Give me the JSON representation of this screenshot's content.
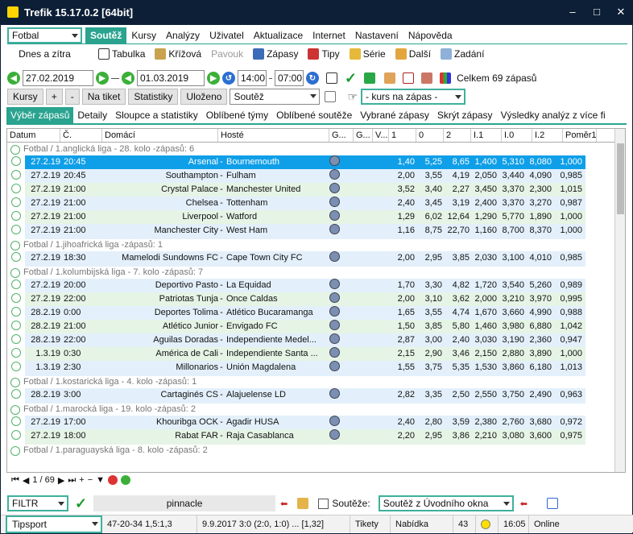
{
  "window": {
    "title": "Trefik 15.17.0.2 [64bit]"
  },
  "sport_select": "Fotbal",
  "menu": [
    "Soutěž",
    "Kursy",
    "Analýzy",
    "Uživatel",
    "Aktualizace",
    "Internet",
    "Nastavení",
    "Nápověda"
  ],
  "period_select": "Dnes a zítra",
  "toolbar": {
    "tabulka": "Tabulka",
    "krizova": "Křížová",
    "pavouk": "Pavouk",
    "zapasy": "Zápasy",
    "tipy": "Tipy",
    "serie": "Série",
    "dalsi": "Další",
    "zadani": "Zadání"
  },
  "dates": {
    "from": "27.02.2019",
    "to": "01.03.2019",
    "time_from": "14:00",
    "time_to": "07:00",
    "celkem": "Celkem 69 zápasů"
  },
  "buttons": {
    "kursy": "Kursy",
    "plus": "+",
    "minus": "-",
    "na_tiket": "Na tiket",
    "statistiky": "Statistiky",
    "ulozeno": "Uloženo",
    "soutez": "Soutěž",
    "kurs": "- kurs na zápas -"
  },
  "tabs": [
    "Výběr zápasů",
    "Detaily",
    "Sloupce a statistiky",
    "Oblíbené týmy",
    "Oblíbené soutěže",
    "Vybrané zápasy",
    "Skrýt zápasy",
    "Výsledky analýz z více fi"
  ],
  "columns": [
    "Datum",
    "Č.",
    "Domácí",
    "Hosté",
    "G...",
    "G...",
    "V...",
    "1",
    "0",
    "2",
    "I.1",
    "I.0",
    "I.2",
    "Poměr1"
  ],
  "groups": [
    {
      "label": "Fotbal / 1.anglická liga - 28. kolo -zápasů: 6",
      "rows": [
        [
          "27.2.19",
          "20:45",
          "Arsenal",
          "Bournemouth",
          "1,40",
          "5,25",
          "8,65",
          "1,400",
          "5,310",
          "8,080",
          "1,000",
          "sel"
        ],
        [
          "27.2.19",
          "20:45",
          "Southampton",
          "Fulham",
          "2,00",
          "3,55",
          "4,19",
          "2,050",
          "3,440",
          "4,090",
          "0,985",
          "alt"
        ],
        [
          "27.2.19",
          "21:00",
          "Crystal Palace",
          "Manchester United",
          "3,52",
          "3,40",
          "2,27",
          "3,450",
          "3,370",
          "2,300",
          "1,015",
          "green-row"
        ],
        [
          "27.2.19",
          "21:00",
          "Chelsea",
          "Tottenham",
          "2,40",
          "3,45",
          "3,19",
          "2,400",
          "3,370",
          "3,270",
          "0,987",
          "alt"
        ],
        [
          "27.2.19",
          "21:00",
          "Liverpool",
          "Watford",
          "1,29",
          "6,02",
          "12,64",
          "1,290",
          "5,770",
          "1,890",
          "1,000",
          "green-row"
        ],
        [
          "27.2.19",
          "21:00",
          "Manchester City",
          "West Ham",
          "1,16",
          "8,75",
          "22,70",
          "1,160",
          "8,700",
          "8,370",
          "1,000",
          "alt"
        ]
      ]
    },
    {
      "label": "Fotbal / 1.jihoafrická liga -zápasů: 1",
      "rows": [
        [
          "27.2.19",
          "18:30",
          "Mamelodi Sundowns FC",
          "Cape Town City FC",
          "2,00",
          "2,95",
          "3,85",
          "2,030",
          "3,100",
          "4,010",
          "0,985",
          "alt"
        ]
      ]
    },
    {
      "label": "Fotbal / 1.kolumbijská liga - 7. kolo -zápasů: 7",
      "rows": [
        [
          "27.2.19",
          "20:00",
          "Deportivo Pasto",
          "La Equidad",
          "1,70",
          "3,30",
          "4,82",
          "1,720",
          "3,540",
          "5,260",
          "0,989",
          "alt"
        ],
        [
          "27.2.19",
          "22:00",
          "Patriotas Tunja",
          "Once Caldas",
          "2,00",
          "3,10",
          "3,62",
          "2,000",
          "3,210",
          "3,970",
          "0,995",
          "green-row"
        ],
        [
          "28.2.19",
          "0:00",
          "Deportes Tolima",
          "Atlético Bucaramanga",
          "1,65",
          "3,55",
          "4,74",
          "1,670",
          "3,660",
          "4,990",
          "0,988",
          "alt"
        ],
        [
          "28.2.19",
          "21:00",
          "Atlético Junior",
          "Envigado FC",
          "1,50",
          "3,85",
          "5,80",
          "1,460",
          "3,980",
          "6,880",
          "1,042",
          "green-row"
        ],
        [
          "28.2.19",
          "22:00",
          "Aguilas Doradas",
          "Independiente Medel...",
          "2,87",
          "3,00",
          "2,40",
          "3,030",
          "3,190",
          "2,360",
          "0,947",
          "alt"
        ],
        [
          "1.3.19",
          "0:30",
          "América de Cali",
          "Independiente Santa ...",
          "2,15",
          "2,90",
          "3,46",
          "2,150",
          "2,880",
          "3,890",
          "1,000",
          "green-row"
        ],
        [
          "1.3.19",
          "2:30",
          "Millonarios",
          "Unión Magdalena",
          "1,55",
          "3,75",
          "5,35",
          "1,530",
          "3,860",
          "6,180",
          "1,013",
          "alt"
        ]
      ]
    },
    {
      "label": "Fotbal / 1.kostarická liga - 4. kolo -zápasů: 1",
      "rows": [
        [
          "28.2.19",
          "3:00",
          "Cartaginés CS",
          "Alajuelense LD",
          "2,82",
          "3,35",
          "2,50",
          "2,550",
          "3,750",
          "2,490",
          "0,963",
          "alt"
        ]
      ]
    },
    {
      "label": "Fotbal / 1.marocká liga - 19. kolo -zápasů: 2",
      "rows": [
        [
          "27.2.19",
          "17:00",
          "Khouribga OCK",
          "Agadir HUSA",
          "2,40",
          "2,80",
          "3,59",
          "2,380",
          "2,760",
          "3,680",
          "0,972",
          "alt"
        ],
        [
          "27.2.19",
          "18:00",
          "Rabat FAR",
          "Raja Casablanca",
          "2,20",
          "2,95",
          "3,86",
          "2,210",
          "3,080",
          "3,600",
          "0,975",
          "green-row"
        ]
      ]
    },
    {
      "label": "Fotbal / 1.paraguayská liga - 8. kolo -zápasů: 2",
      "rows": []
    }
  ],
  "pager": {
    "position": "1 / 69"
  },
  "bottom": {
    "filtr": "FILTR",
    "pinnacle": "pinnacle",
    "souteze": "Soutěže:",
    "souteze_select": "Soutěž z Úvodního okna"
  },
  "status": {
    "sport": "Tipsport",
    "score": "47-20-34  1,5:1,3",
    "result": "9.9.2017 3:0 (2:0, 1:0) ... [1,32]",
    "tikety": "Tikety",
    "nabidka": "Nabídka",
    "count": "43",
    "time": "16:05",
    "online": "Online"
  },
  "colors": {
    "accent": "#2aa38f",
    "titlebar": "#0c1f36",
    "selected": "#0f9fe8"
  }
}
